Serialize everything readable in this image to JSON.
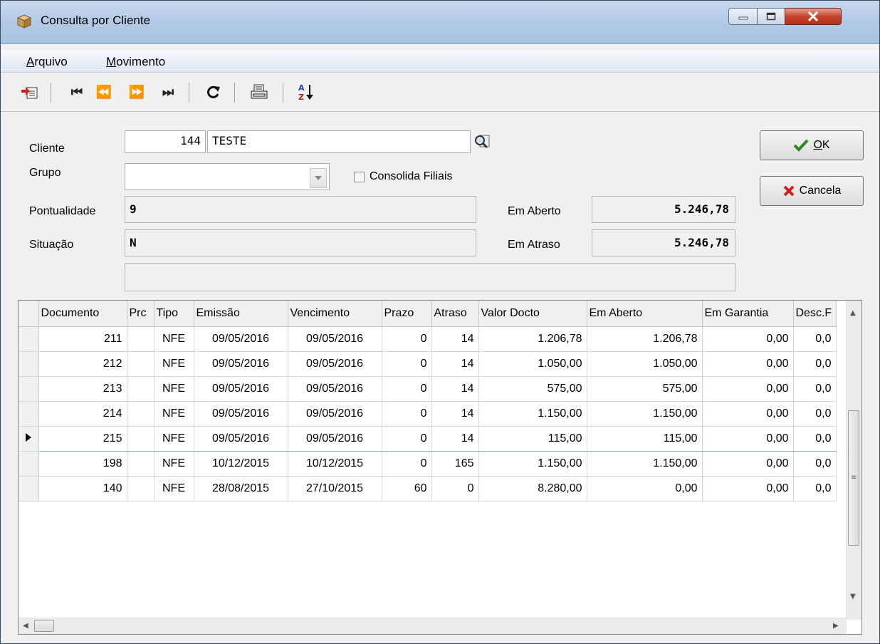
{
  "window": {
    "title": "Consulta por Cliente"
  },
  "menu": {
    "items": [
      {
        "accel": "A",
        "rest": "rquivo"
      },
      {
        "accel": "M",
        "rest": "ovimento"
      }
    ]
  },
  "toolbar": {
    "first": "⏮",
    "prev": "⏪",
    "next": "⏩",
    "last": "⏭"
  },
  "form": {
    "cliente_label": "Cliente",
    "cliente_code": "144",
    "cliente_name": "TESTE",
    "grupo_label": "Grupo",
    "grupo_value": "",
    "consolida_label": "Consolida Filiais",
    "pontualidade_label": "Pontualidade",
    "pontualidade_value": "9",
    "situacao_label": "Situação",
    "situacao_value": "N",
    "em_aberto_label": "Em Aberto",
    "em_aberto_value": "5.246,78",
    "em_atraso_label": "Em Atraso",
    "em_atraso_value": "5.246,78",
    "extra_value": ""
  },
  "buttons": {
    "ok": "OK",
    "ok_accel": "O",
    "ok_rest": "K",
    "cancel": "Cancela"
  },
  "grid": {
    "columns": [
      "Documento",
      "Prc",
      "Tipo",
      "Emissão",
      "Vencimento",
      "Prazo",
      "Atraso",
      "Valor Docto",
      "Em Aberto",
      "Em Garantia",
      "Desc.F"
    ],
    "rows": [
      [
        "211",
        "",
        "NFE",
        "09/05/2016",
        "09/05/2016",
        "0",
        "14",
        "1.206,78",
        "1.206,78",
        "0,00",
        "0,0"
      ],
      [
        "212",
        "",
        "NFE",
        "09/05/2016",
        "09/05/2016",
        "0",
        "14",
        "1.050,00",
        "1.050,00",
        "0,00",
        "0,0"
      ],
      [
        "213",
        "",
        "NFE",
        "09/05/2016",
        "09/05/2016",
        "0",
        "14",
        "575,00",
        "575,00",
        "0,00",
        "0,0"
      ],
      [
        "214",
        "",
        "NFE",
        "09/05/2016",
        "09/05/2016",
        "0",
        "14",
        "1.150,00",
        "1.150,00",
        "0,00",
        "0,0"
      ],
      [
        "215",
        "",
        "NFE",
        "09/05/2016",
        "09/05/2016",
        "0",
        "14",
        "115,00",
        "115,00",
        "0,00",
        "0,0"
      ],
      [
        "198",
        "",
        "NFE",
        "10/12/2015",
        "10/12/2015",
        "0",
        "165",
        "1.150,00",
        "1.150,00",
        "0,00",
        "0,0"
      ],
      [
        "140",
        "",
        "NFE",
        "28/08/2015",
        "27/10/2015",
        "60",
        "0",
        "8.280,00",
        "0,00",
        "0,00",
        "0,0"
      ]
    ],
    "selected_row": 4
  },
  "colors": {
    "title_gradient": "#b4cbe6",
    "close_button": "#c5452c",
    "selection_border": "#8db2e3"
  }
}
